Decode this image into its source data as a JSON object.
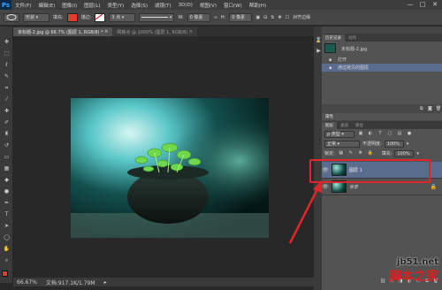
{
  "app": {
    "logo": "Ps"
  },
  "menu": [
    "文件(F)",
    "编辑(E)",
    "图像(I)",
    "图层(L)",
    "类型(Y)",
    "选择(S)",
    "滤镜(T)",
    "3D(D)",
    "视图(V)",
    "窗口(W)",
    "帮助(H)"
  ],
  "window_controls": {
    "minimize": "—",
    "maximize": "□",
    "close": "✕"
  },
  "options": {
    "shape_mode": "形状",
    "fill_label": "填充:",
    "stroke_label": "描边:",
    "stroke_width": "3 点",
    "w_label": "W:",
    "w_value": "0 像素",
    "h_label": "H:",
    "h_value": "0 像素",
    "align_edges": "对齐边缘",
    "fill_color": "#e23b2e"
  },
  "tabs": [
    {
      "label": "未标题-2.jpg @ 66.7% (图层 1, RGB/8) *",
      "close": "×"
    },
    {
      "label": "网格点 @ 1000% (图层 1, RGB/8)",
      "close": "×"
    }
  ],
  "status": {
    "zoom": "66.67%",
    "doc": "文档:917.1K/1.79M"
  },
  "history_panel": {
    "tabs": [
      "历史记录",
      "动作"
    ],
    "snapshot": "未标题-2.jpg",
    "items": [
      "打开",
      "通过拷贝的图层"
    ]
  },
  "layers_panel": {
    "tabs": [
      "图层",
      "通道",
      "路径"
    ],
    "properties_tab": "属性",
    "kind_filter": "ρ 类型",
    "blend_mode": "正常",
    "opacity_label": "不透明度:",
    "opacity_value": "100%",
    "lock_label": "锁定:",
    "fill_label": "填充:",
    "fill_value": "100%",
    "layers": [
      {
        "name": "图层 1",
        "selected": true
      },
      {
        "name": "背景",
        "selected": false
      }
    ],
    "footer_icons": [
      "link-icon",
      "fx-icon",
      "mask-icon",
      "adjustment-icon",
      "folder-icon",
      "new-layer-icon",
      "trash-icon"
    ]
  },
  "watermark": {
    "line1": "jb51.net",
    "line2": "脚本之家"
  },
  "colors": {
    "accent_red": "#e0262b",
    "selection_blue": "#5b6d8f",
    "foreground": "#e23b2e"
  }
}
